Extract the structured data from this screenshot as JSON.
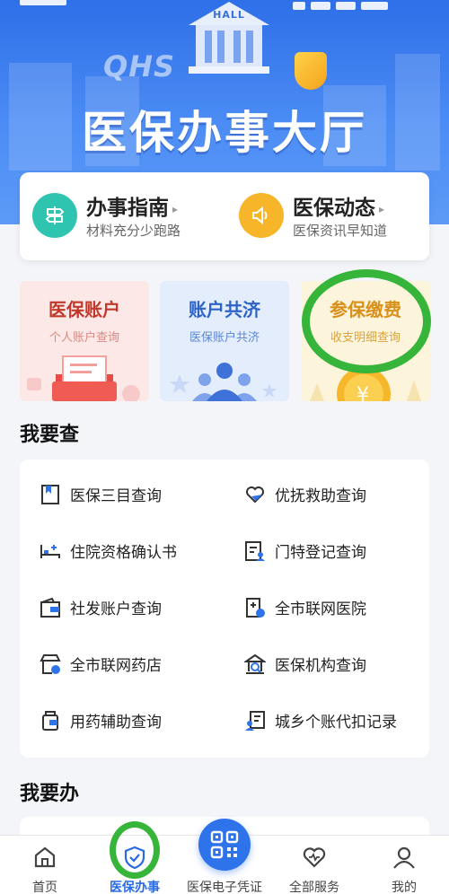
{
  "banner": {
    "title": "医保办事大厅",
    "hall_label": "HALL",
    "logo_text": "QHS"
  },
  "top_card": {
    "items": [
      {
        "title": "办事指南",
        "subtitle": "材料充分少跑路",
        "icon": "signpost-icon",
        "color": "#2ec4b0"
      },
      {
        "title": "医保动态",
        "subtitle": "医保资讯早知道",
        "icon": "speaker-icon",
        "color": "#f7b62a"
      }
    ]
  },
  "feature_cards": [
    {
      "title": "医保账户",
      "subtitle": "个人账户查询",
      "bg": "#fde8e8",
      "title_color": "#c0392b",
      "sub_color": "#d88a82"
    },
    {
      "title": "账户共济",
      "subtitle": "医保账户共济",
      "bg": "#e4edfc",
      "title_color": "#2c63c6",
      "sub_color": "#5b86d6"
    },
    {
      "title": "参保缴费",
      "subtitle": "收支明细查询",
      "bg": "#fdf4dc",
      "title_color": "#d8901a",
      "sub_color": "#d9a33b"
    }
  ],
  "query_section": {
    "title": "我要查",
    "items": [
      {
        "label": "医保三目查询",
        "icon": "bookmark-icon"
      },
      {
        "label": "优抚救助查询",
        "icon": "heart-hand-icon"
      },
      {
        "label": "住院资格确认书",
        "icon": "bed-icon"
      },
      {
        "label": "门特登记查询",
        "icon": "registration-icon"
      },
      {
        "label": "社发账户查询",
        "icon": "wallet-icon"
      },
      {
        "label": "全市联网医院",
        "icon": "hospital-icon"
      },
      {
        "label": "全市联网药店",
        "icon": "pharmacy-icon"
      },
      {
        "label": "医保机构查询",
        "icon": "institution-icon"
      },
      {
        "label": "用药辅助查询",
        "icon": "medicine-bottle-icon"
      },
      {
        "label": "城乡个账代扣记录",
        "icon": "record-icon"
      }
    ]
  },
  "handle_section": {
    "title": "我要办"
  },
  "bottom_nav": {
    "items": [
      {
        "label": "首页",
        "icon": "home-icon"
      },
      {
        "label": "医保办事",
        "icon": "shield-check-icon"
      },
      {
        "label": "医保电子凭证",
        "icon": "qr-code-icon"
      },
      {
        "label": "全部服务",
        "icon": "heart-service-icon"
      },
      {
        "label": "我的",
        "icon": "user-icon"
      }
    ],
    "active": "医保办事"
  },
  "colors": {
    "accent": "#2f73ea",
    "highlight": "#36b53a"
  }
}
